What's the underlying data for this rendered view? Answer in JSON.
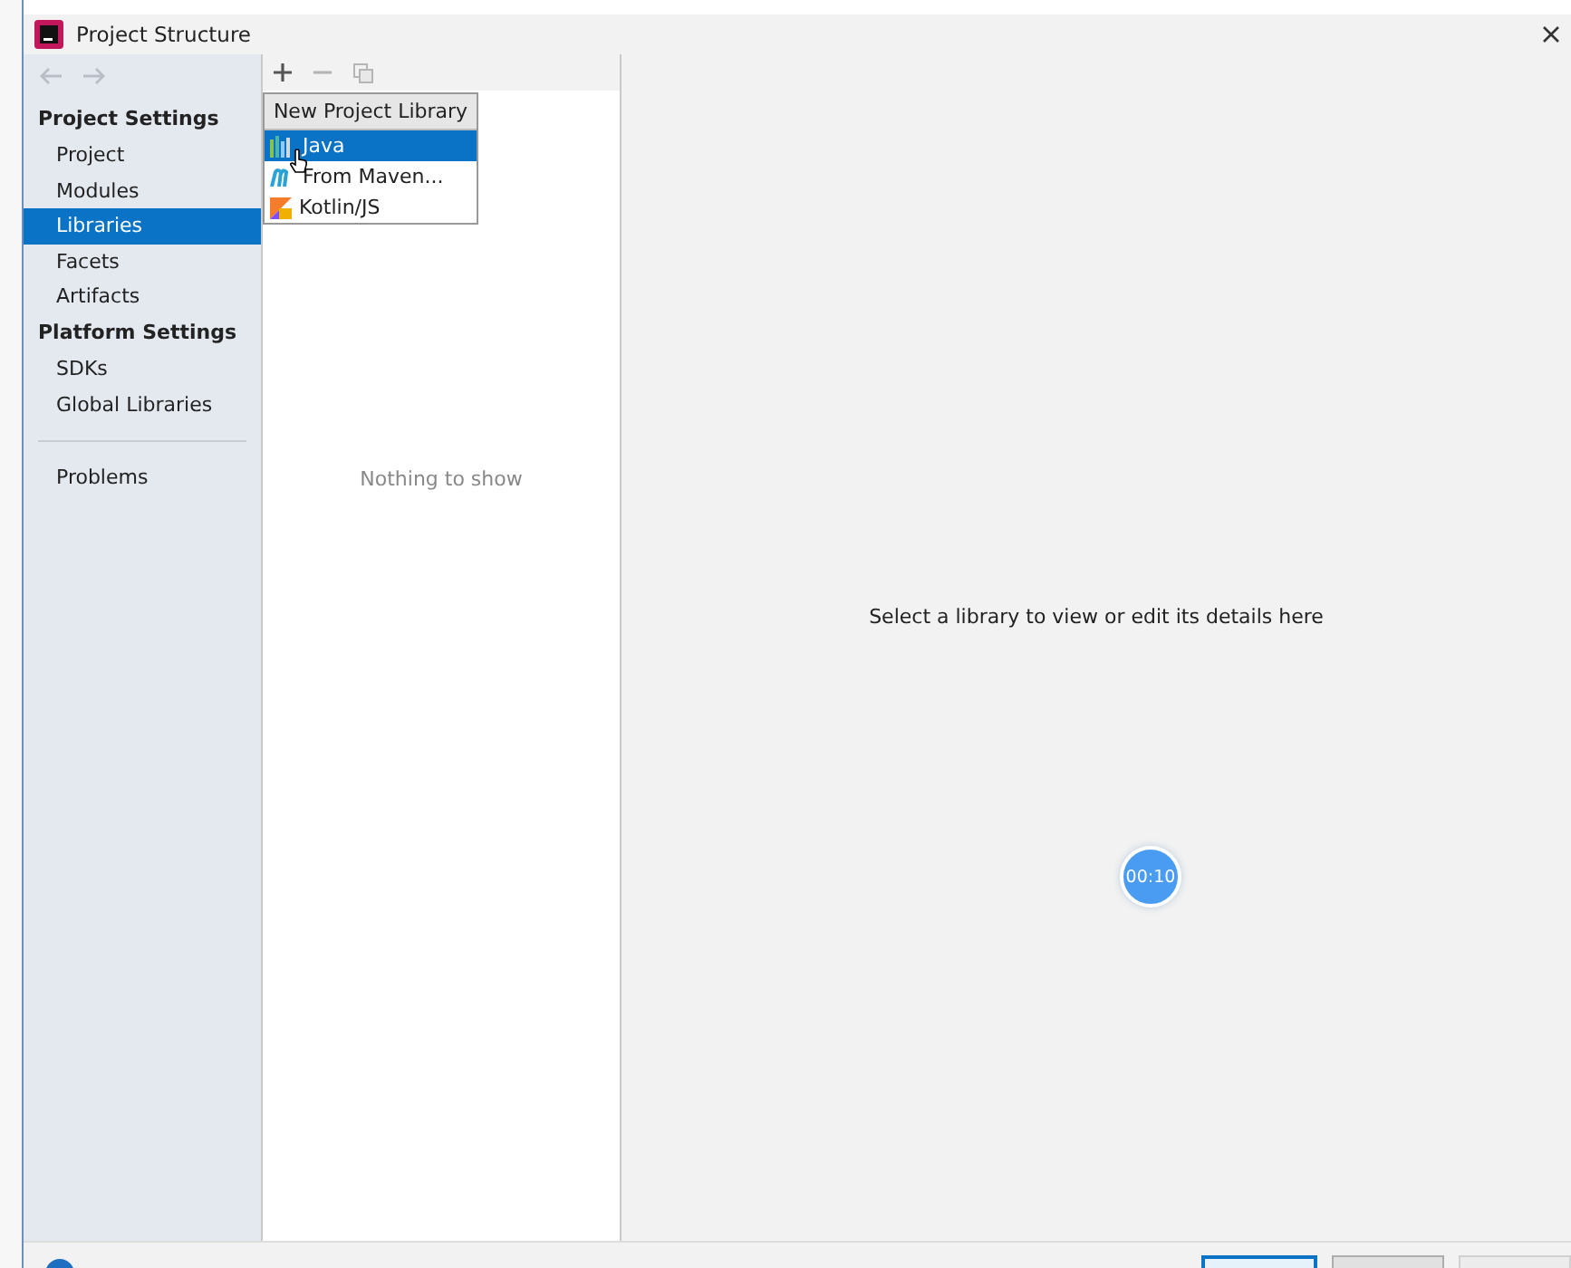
{
  "window": {
    "title": "Project Structure"
  },
  "sidebar": {
    "sections": [
      {
        "title": "Project Settings",
        "items": [
          {
            "label": "Project",
            "selected": false
          },
          {
            "label": "Modules",
            "selected": false
          },
          {
            "label": "Libraries",
            "selected": true
          },
          {
            "label": "Facets",
            "selected": false
          },
          {
            "label": "Artifacts",
            "selected": false
          }
        ]
      },
      {
        "title": "Platform Settings",
        "items": [
          {
            "label": "SDKs",
            "selected": false
          },
          {
            "label": "Global Libraries",
            "selected": false
          }
        ]
      }
    ],
    "extra_items": [
      {
        "label": "Problems",
        "selected": false
      }
    ]
  },
  "libraries": {
    "empty_text": "Nothing to show"
  },
  "popup": {
    "title": "New Project Library",
    "items": [
      {
        "label": "Java",
        "kind": "java",
        "selected": true
      },
      {
        "label": "From Maven...",
        "kind": "maven",
        "selected": false
      },
      {
        "label": "Kotlin/JS",
        "kind": "kotlin",
        "selected": false
      }
    ]
  },
  "details": {
    "hint": "Select a library to view or edit its details here"
  },
  "timer": {
    "text": "00:10"
  }
}
